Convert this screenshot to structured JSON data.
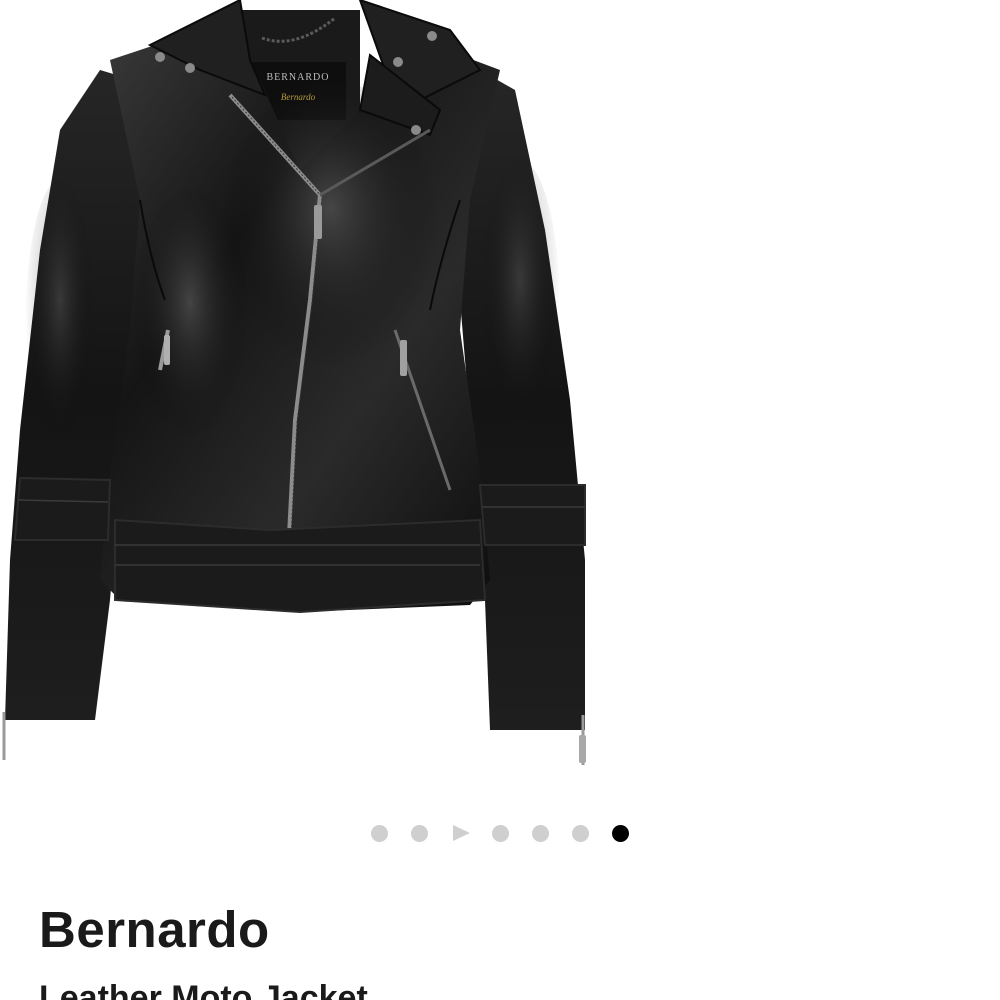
{
  "product": {
    "brand": "Bernardo",
    "name": "Leather Moto Jacket",
    "image": {
      "label_brand": "BERNARDO",
      "label_script": "Bernardo"
    }
  },
  "carousel": {
    "items": [
      {
        "type": "dot",
        "active": false
      },
      {
        "type": "dot",
        "active": false
      },
      {
        "type": "play",
        "active": false
      },
      {
        "type": "dot",
        "active": false
      },
      {
        "type": "dot",
        "active": false
      },
      {
        "type": "dot",
        "active": false
      },
      {
        "type": "dot",
        "active": true
      }
    ],
    "colors": {
      "inactive": "#cfcfcf",
      "active": "#000000"
    }
  },
  "icons": {
    "video": "play-icon"
  }
}
